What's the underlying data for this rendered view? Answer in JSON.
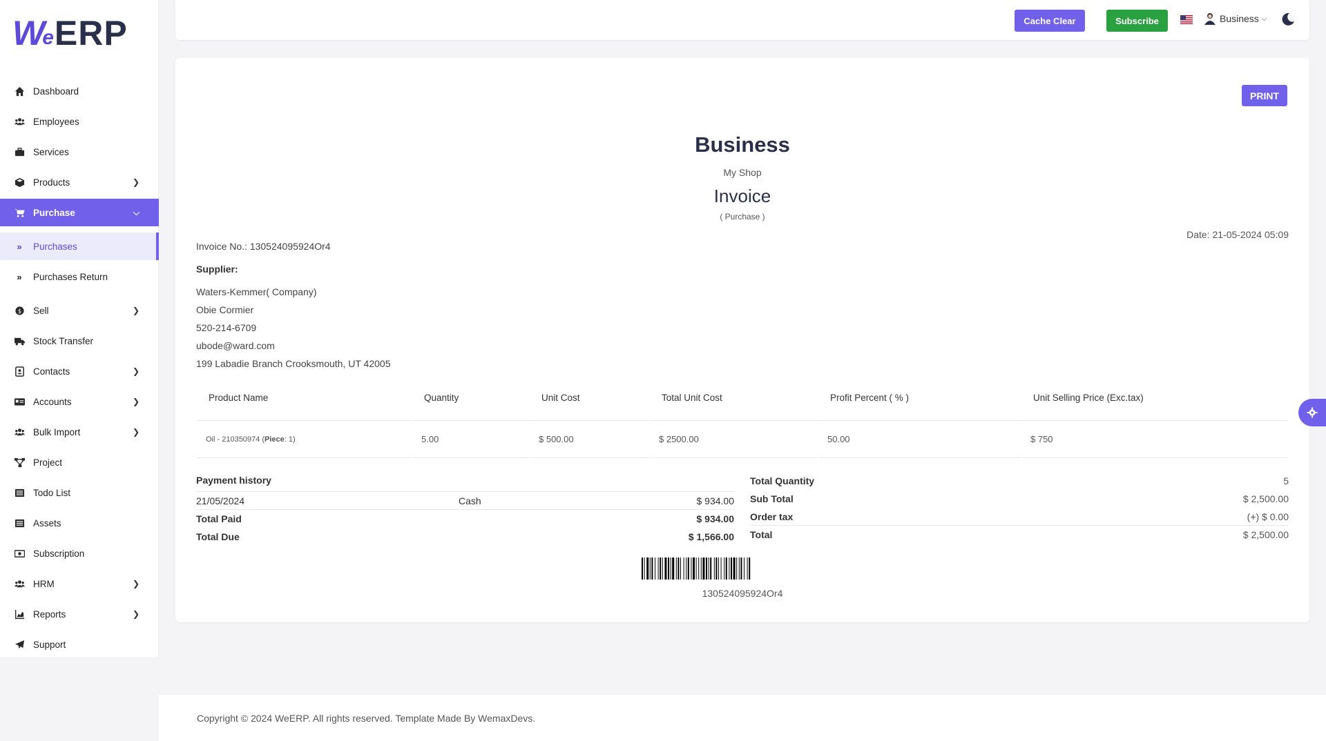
{
  "app": {
    "logo_we": "W",
    "logo_e": "e",
    "logo_erp": "ERP"
  },
  "sidebar": {
    "items": [
      {
        "label": "Dashboard",
        "icon": "home-icon"
      },
      {
        "label": "Employees",
        "icon": "users-icon"
      },
      {
        "label": "Services",
        "icon": "briefcase-icon"
      },
      {
        "label": "Products",
        "icon": "box-icon"
      },
      {
        "label": "Purchase",
        "icon": "cart-icon"
      },
      {
        "label": "Purchases",
        "icon": "double-chevron-icon"
      },
      {
        "label": "Purchases Return",
        "icon": "double-chevron-icon"
      },
      {
        "label": "Sell",
        "icon": "dollar-icon"
      },
      {
        "label": "Stock Transfer",
        "icon": "truck-icon"
      },
      {
        "label": "Contacts",
        "icon": "contacts-icon"
      },
      {
        "label": "Accounts",
        "icon": "id-card-icon"
      },
      {
        "label": "Bulk Import",
        "icon": "users-icon"
      },
      {
        "label": "Project",
        "icon": "project-icon"
      },
      {
        "label": "Todo List",
        "icon": "list-icon"
      },
      {
        "label": "Assets",
        "icon": "list-icon"
      },
      {
        "label": "Subscription",
        "icon": "money-icon"
      },
      {
        "label": "HRM",
        "icon": "users-icon"
      },
      {
        "label": "Reports",
        "icon": "chart-icon"
      },
      {
        "label": "Support",
        "icon": "send-icon"
      }
    ]
  },
  "topbar": {
    "cache_clear": "Cache Clear",
    "subscribe": "Subscribe",
    "user": "Business",
    "accent": "#7060ea",
    "subscribe_color": "#2aa140"
  },
  "invoice": {
    "print_label": "PRINT",
    "business": "Business",
    "shop": "My Shop",
    "title": "Invoice",
    "kind": "( Purchase )",
    "date": "Date: 21-05-2024 05:09",
    "invoice_no": "Invoice No.: 130524095924Or4",
    "supplier_label": "Supplier:",
    "supplier": {
      "company": "Waters-Kemmer( Company)",
      "name": "Obie Cormier",
      "phone": "520-214-6709",
      "email": "ubode@ward.com",
      "address": "199 Labadie Branch Crooksmouth, UT 42005"
    },
    "table": {
      "headers": [
        "Product Name",
        "Quantity",
        "Unit Cost",
        "Total Unit Cost",
        "Profit Percent ( % )",
        "Unit Selling Price (Exc.tax)"
      ],
      "rows": [
        {
          "product": "Oil - 210350974 (",
          "piece_label": "Piece",
          "piece_tail": ": 1)",
          "quantity": "5.00",
          "unit_cost": "$ 500.00",
          "total_unit_cost": "$ 2500.00",
          "profit_percent": "50.00",
          "unit_selling_price": "$ 750"
        }
      ]
    },
    "payment": {
      "heading": "Payment history",
      "date": "21/05/2024",
      "method": "Cash",
      "amount": "$ 934.00",
      "total_paid_label": "Total Paid",
      "total_paid": "$ 934.00",
      "total_due_label": "Total Due",
      "total_due": "$ 1,566.00"
    },
    "totals": {
      "qty_label": "Total Quantity",
      "qty": "5",
      "sub_label": "Sub Total",
      "sub": "$ 2,500.00",
      "tax_label": "Order tax",
      "tax": "(+) $ 0.00",
      "total_label": "Total",
      "total": "$ 2,500.00"
    },
    "barcode_text": "130524095924Or4"
  },
  "footer": {
    "text": "Copyright © 2024 WeERP. All rights reserved. Template Made By WemaxDevs."
  }
}
